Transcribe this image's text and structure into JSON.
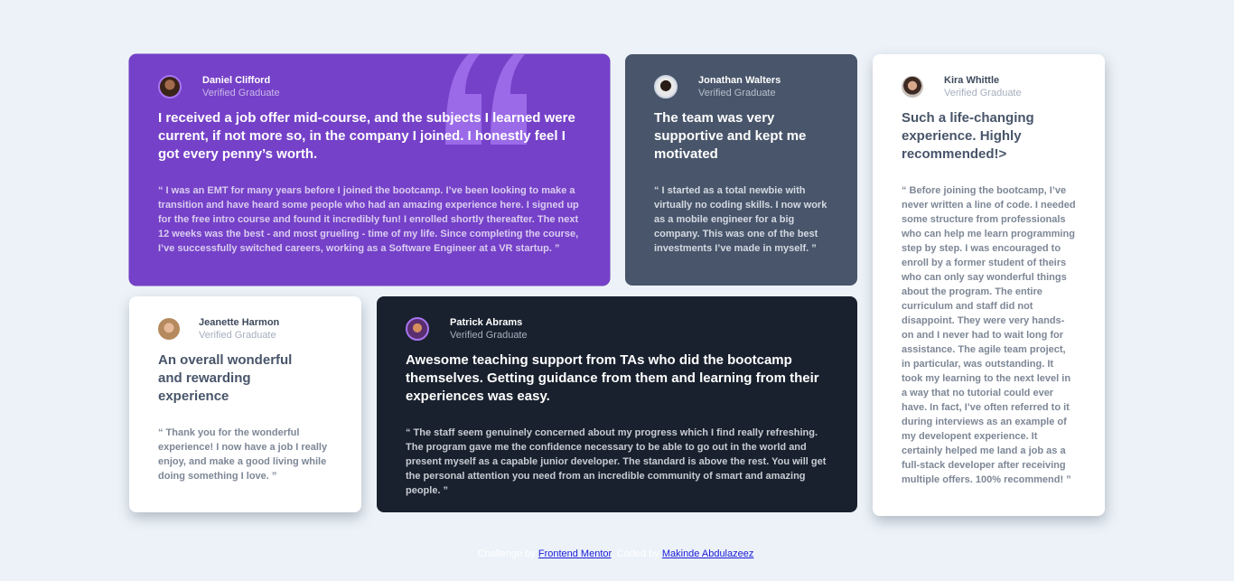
{
  "testimonials": [
    {
      "name": "Daniel Clifford",
      "role": "Verified Graduate",
      "headline": "I received a job offer mid-course, and the subjects I learned were current, if not more so, in the company I joined. I honestly feel I got every penny’s worth.",
      "quote": "“ I was an EMT for many years before I joined the bootcamp. I’ve been looking to make a transition and have heard some people who had an amazing experience here. I signed up for the free intro course and found it incredibly fun! I enrolled shortly thereafter. The next 12 weeks was the best - and most grueling - time of my life. Since completing the course, I’ve successfully switched careers, working as a Software Engineer at a VR startup. ”"
    },
    {
      "name": "Jonathan Walters",
      "role": "Verified Graduate",
      "headline": "The team was very supportive and kept me motivated",
      "quote": "“ I started as a total newbie with virtually no coding skills. I now work as a mobile engineer for a big company. This was one of the best investments I’ve made in myself. ”"
    },
    {
      "name": "Kira Whittle",
      "role": "Verified Graduate",
      "headline": "Such a life-changing experience. Highly recommended!>",
      "quote": "“ Before joining the bootcamp, I’ve never written a line of code. I needed some structure from professionals who can help me learn programming step by step. I was encouraged to enroll by a former student of theirs who can only say wonderful things about the program. The entire curriculum and staff did not disappoint. They were very hands-on and I never had to wait long for assistance. The agile team project, in particular, was outstanding. It took my learning to the next level in a way that no tutorial could ever have. In fact, I’ve often referred to it during interviews as an example of my developent experience. It certainly helped me land a job as a full-stack developer after receiving multiple offers. 100% recommend! ”"
    },
    {
      "name": "Jeanette Harmon",
      "role": "Verified Graduate",
      "headline": "An overall wonderful and rewarding experience",
      "quote": "“ Thank you for the wonderful experience! I now have a job I really enjoy, and make a good living while doing something I love. ”"
    },
    {
      "name": "Patrick Abrams",
      "role": "Verified Graduate",
      "headline": "Awesome teaching support from TAs who did the bootcamp themselves. Getting guidance from them and learning from their experiences was easy.",
      "quote": "“ The staff seem genuinely concerned about my progress which I find really refreshing. The program gave me the confidence necessary to be able to go out in the world and present myself as a capable junior developer. The standard is above the rest. You will get the personal attention you need from an incredible community of smart and amazing people. ”"
    }
  ],
  "footer": {
    "challenge_text": "Challenge by",
    "challenge_link": "Frontend Mentor",
    "coded_text": "Coded by",
    "coded_link": "Makinde Abdulazeez"
  },
  "colors": {
    "background": "#ecf2f8",
    "purple": "#7541c8",
    "slate": "#48556a",
    "dark": "#19212e",
    "white": "#ffffff"
  }
}
